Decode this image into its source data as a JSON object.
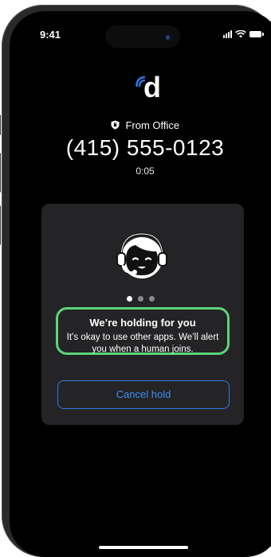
{
  "status_bar": {
    "time": "9:41"
  },
  "logo": {
    "letter": "d"
  },
  "call": {
    "from_label": "From Office",
    "phone_number": "(415) 555-0123",
    "duration": "0:05"
  },
  "hold_card": {
    "title": "We’re holding for you",
    "message": "It’s okay to use other apps. We’ll alert you when a human joins.",
    "cancel_label": "Cancel hold",
    "pager": {
      "total": 3,
      "active_index": 0
    }
  },
  "colors": {
    "accent_blue": "#3d8bf0",
    "highlight_green": "#5cd47a",
    "card_bg": "#242426"
  },
  "icons": [
    "logo-signal-icon",
    "shield-lock-icon",
    "agent-headset-icon",
    "signal-bars-icon",
    "wifi-icon",
    "battery-icon"
  ]
}
